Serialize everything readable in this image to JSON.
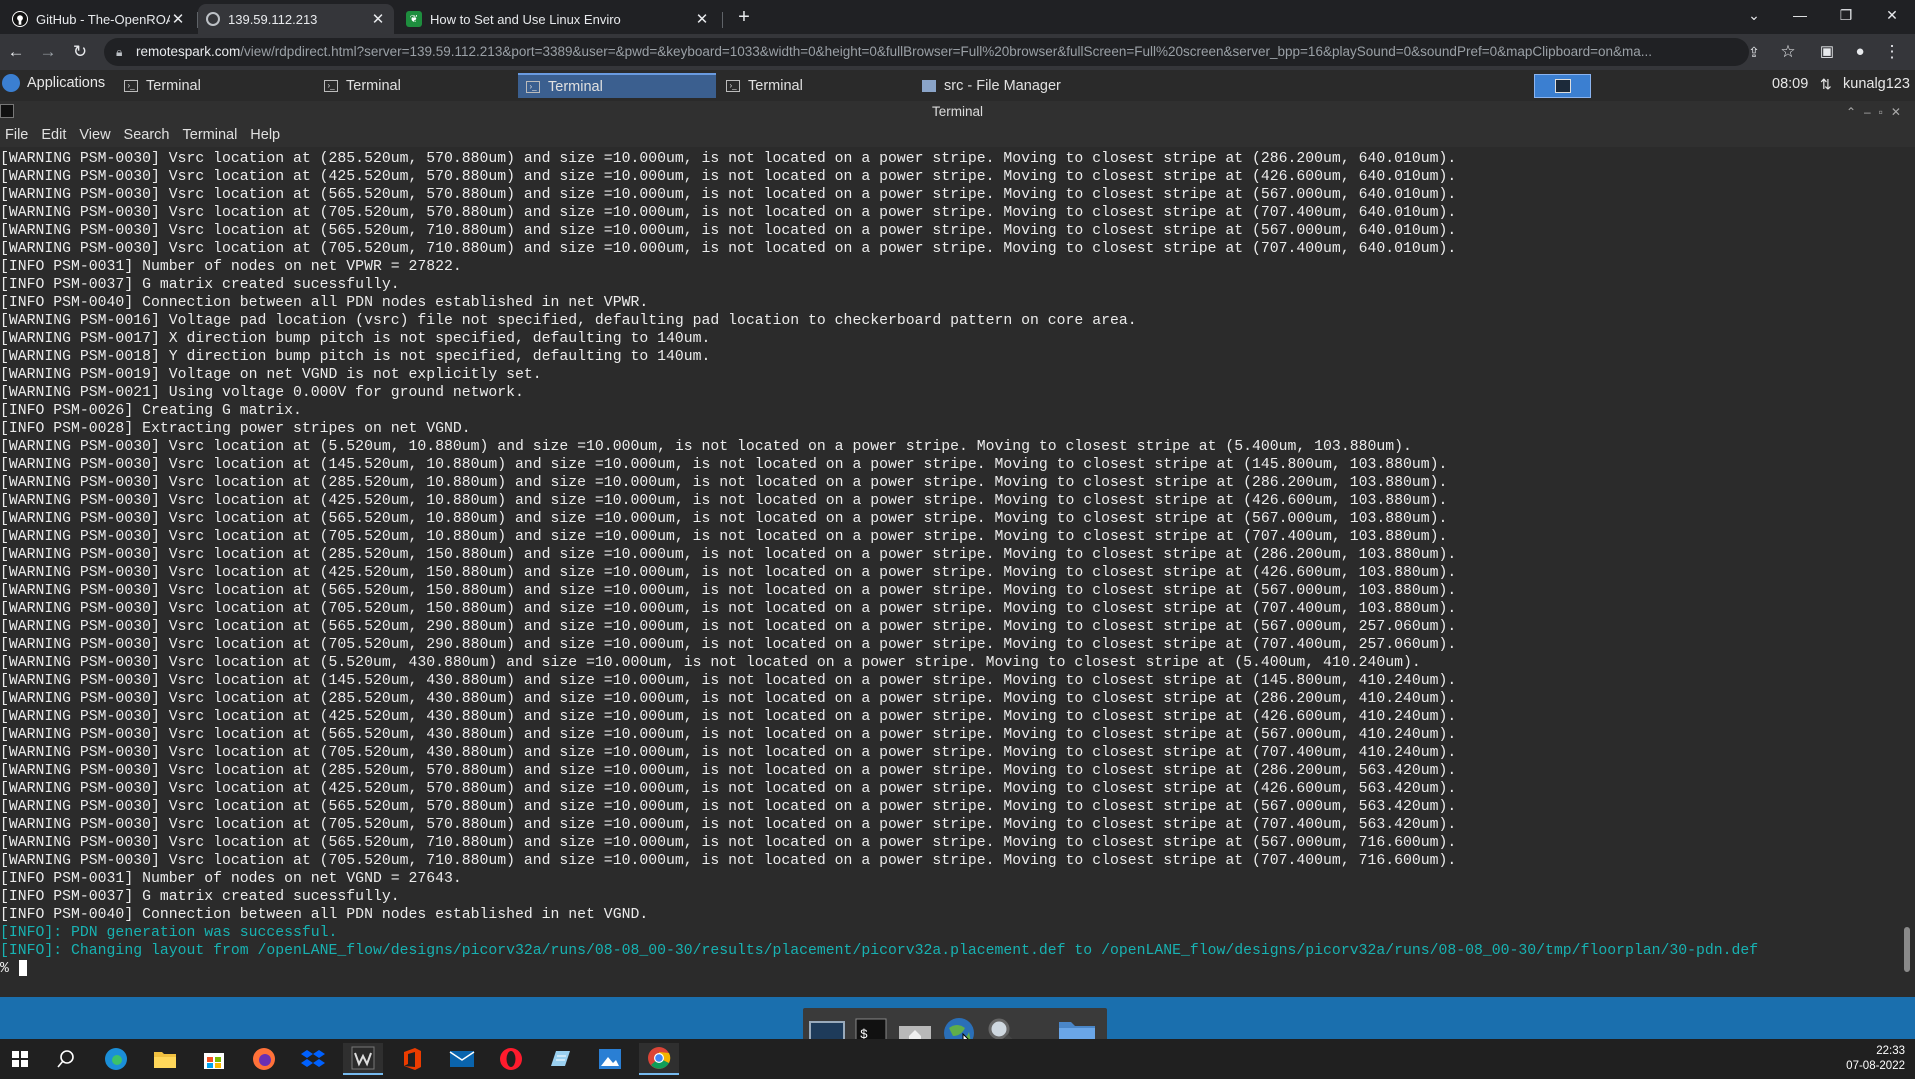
{
  "browser": {
    "tabs": [
      {
        "title": "GitHub - The-OpenROAD-Project",
        "icon": "github-icon"
      },
      {
        "title": "139.59.112.213",
        "icon": "globe-icon"
      },
      {
        "title": "How to Set and Use Linux Enviro",
        "icon": "leaf-icon"
      }
    ],
    "new_tab_label": "+",
    "url_host": "remotespark.com",
    "url_rest": "/view/rdpdirect.html?server=139.59.112.213&port=3389&user=&pwd=&keyboard=1033&width=0&height=0&fullBrowser=Full%20browser&fullScreen=Full%20screen&server_bpp=16&playSound=0&soundPref=0&mapClipboard=on&ma..."
  },
  "xfce_panel": {
    "applications_label": "Applications",
    "tasks": [
      {
        "label": "Terminal",
        "active": false
      },
      {
        "label": "Terminal",
        "active": false
      },
      {
        "label": "Terminal",
        "active": true
      },
      {
        "label": "Terminal",
        "active": false
      },
      {
        "label": "src - File Manager",
        "active": false
      }
    ],
    "clock": "08:09",
    "user": "kunalg123"
  },
  "terminal": {
    "title": "Terminal",
    "menu": [
      "File",
      "Edit",
      "View",
      "Search",
      "Terminal",
      "Help"
    ],
    "lines": [
      "[WARNING PSM-0030] Vsrc location at (285.520um, 570.880um) and size =10.000um, is not located on a power stripe. Moving to closest stripe at (286.200um, 640.010um).",
      "[WARNING PSM-0030] Vsrc location at (425.520um, 570.880um) and size =10.000um, is not located on a power stripe. Moving to closest stripe at (426.600um, 640.010um).",
      "[WARNING PSM-0030] Vsrc location at (565.520um, 570.880um) and size =10.000um, is not located on a power stripe. Moving to closest stripe at (567.000um, 640.010um).",
      "[WARNING PSM-0030] Vsrc location at (705.520um, 570.880um) and size =10.000um, is not located on a power stripe. Moving to closest stripe at (707.400um, 640.010um).",
      "[WARNING PSM-0030] Vsrc location at (565.520um, 710.880um) and size =10.000um, is not located on a power stripe. Moving to closest stripe at (567.000um, 640.010um).",
      "[WARNING PSM-0030] Vsrc location at (705.520um, 710.880um) and size =10.000um, is not located on a power stripe. Moving to closest stripe at (707.400um, 640.010um).",
      "[INFO PSM-0031] Number of nodes on net VPWR = 27822.",
      "[INFO PSM-0037] G matrix created sucessfully.",
      "[INFO PSM-0040] Connection between all PDN nodes established in net VPWR.",
      "[WARNING PSM-0016] Voltage pad location (vsrc) file not specified, defaulting pad location to checkerboard pattern on core area.",
      "[WARNING PSM-0017] X direction bump pitch is not specified, defaulting to 140um.",
      "[WARNING PSM-0018] Y direction bump pitch is not specified, defaulting to 140um.",
      "[WARNING PSM-0019] Voltage on net VGND is not explicitly set.",
      "[WARNING PSM-0021] Using voltage 0.000V for ground network.",
      "[INFO PSM-0026] Creating G matrix.",
      "[INFO PSM-0028] Extracting power stripes on net VGND.",
      "[WARNING PSM-0030] Vsrc location at (5.520um, 10.880um) and size =10.000um, is not located on a power stripe. Moving to closest stripe at (5.400um, 103.880um).",
      "[WARNING PSM-0030] Vsrc location at (145.520um, 10.880um) and size =10.000um, is not located on a power stripe. Moving to closest stripe at (145.800um, 103.880um).",
      "[WARNING PSM-0030] Vsrc location at (285.520um, 10.880um) and size =10.000um, is not located on a power stripe. Moving to closest stripe at (286.200um, 103.880um).",
      "[WARNING PSM-0030] Vsrc location at (425.520um, 10.880um) and size =10.000um, is not located on a power stripe. Moving to closest stripe at (426.600um, 103.880um).",
      "[WARNING PSM-0030] Vsrc location at (565.520um, 10.880um) and size =10.000um, is not located on a power stripe. Moving to closest stripe at (567.000um, 103.880um).",
      "[WARNING PSM-0030] Vsrc location at (705.520um, 10.880um) and size =10.000um, is not located on a power stripe. Moving to closest stripe at (707.400um, 103.880um).",
      "[WARNING PSM-0030] Vsrc location at (285.520um, 150.880um) and size =10.000um, is not located on a power stripe. Moving to closest stripe at (286.200um, 103.880um).",
      "[WARNING PSM-0030] Vsrc location at (425.520um, 150.880um) and size =10.000um, is not located on a power stripe. Moving to closest stripe at (426.600um, 103.880um).",
      "[WARNING PSM-0030] Vsrc location at (565.520um, 150.880um) and size =10.000um, is not located on a power stripe. Moving to closest stripe at (567.000um, 103.880um).",
      "[WARNING PSM-0030] Vsrc location at (705.520um, 150.880um) and size =10.000um, is not located on a power stripe. Moving to closest stripe at (707.400um, 103.880um).",
      "[WARNING PSM-0030] Vsrc location at (565.520um, 290.880um) and size =10.000um, is not located on a power stripe. Moving to closest stripe at (567.000um, 257.060um).",
      "[WARNING PSM-0030] Vsrc location at (705.520um, 290.880um) and size =10.000um, is not located on a power stripe. Moving to closest stripe at (707.400um, 257.060um).",
      "[WARNING PSM-0030] Vsrc location at (5.520um, 430.880um) and size =10.000um, is not located on a power stripe. Moving to closest stripe at (5.400um, 410.240um).",
      "[WARNING PSM-0030] Vsrc location at (145.520um, 430.880um) and size =10.000um, is not located on a power stripe. Moving to closest stripe at (145.800um, 410.240um).",
      "[WARNING PSM-0030] Vsrc location at (285.520um, 430.880um) and size =10.000um, is not located on a power stripe. Moving to closest stripe at (286.200um, 410.240um).",
      "[WARNING PSM-0030] Vsrc location at (425.520um, 430.880um) and size =10.000um, is not located on a power stripe. Moving to closest stripe at (426.600um, 410.240um).",
      "[WARNING PSM-0030] Vsrc location at (565.520um, 430.880um) and size =10.000um, is not located on a power stripe. Moving to closest stripe at (567.000um, 410.240um).",
      "[WARNING PSM-0030] Vsrc location at (705.520um, 430.880um) and size =10.000um, is not located on a power stripe. Moving to closest stripe at (707.400um, 410.240um).",
      "[WARNING PSM-0030] Vsrc location at (285.520um, 570.880um) and size =10.000um, is not located on a power stripe. Moving to closest stripe at (286.200um, 563.420um).",
      "[WARNING PSM-0030] Vsrc location at (425.520um, 570.880um) and size =10.000um, is not located on a power stripe. Moving to closest stripe at (426.600um, 563.420um).",
      "[WARNING PSM-0030] Vsrc location at (565.520um, 570.880um) and size =10.000um, is not located on a power stripe. Moving to closest stripe at (567.000um, 563.420um).",
      "[WARNING PSM-0030] Vsrc location at (705.520um, 570.880um) and size =10.000um, is not located on a power stripe. Moving to closest stripe at (707.400um, 563.420um).",
      "[WARNING PSM-0030] Vsrc location at (565.520um, 710.880um) and size =10.000um, is not located on a power stripe. Moving to closest stripe at (567.000um, 716.600um).",
      "[WARNING PSM-0030] Vsrc location at (705.520um, 710.880um) and size =10.000um, is not located on a power stripe. Moving to closest stripe at (707.400um, 716.600um).",
      "[INFO PSM-0031] Number of nodes on net VGND = 27643.",
      "[INFO PSM-0037] G matrix created sucessfully.",
      "[INFO PSM-0040] Connection between all PDN nodes established in net VGND."
    ],
    "info_lines": [
      "[INFO]: PDN generation was successful.",
      "[INFO]: Changing layout from /openLANE_flow/designs/picorv32a/runs/08-08_00-30/results/placement/picorv32a.placement.def to /openLANE_flow/designs/picorv32a/runs/08-08_00-30/tmp/floorplan/30-pdn.def"
    ],
    "prompt": "%",
    "info_color": "#18b2b2"
  },
  "dock": {
    "items": [
      "desktop-icon",
      "terminal-icon",
      "home-folder-icon",
      "web-browser-icon",
      "search-icon",
      "folder-icon"
    ],
    "terminal_glyph": "$_"
  },
  "windows_taskbar": {
    "time": "22:33",
    "date": "07-08-2022"
  }
}
